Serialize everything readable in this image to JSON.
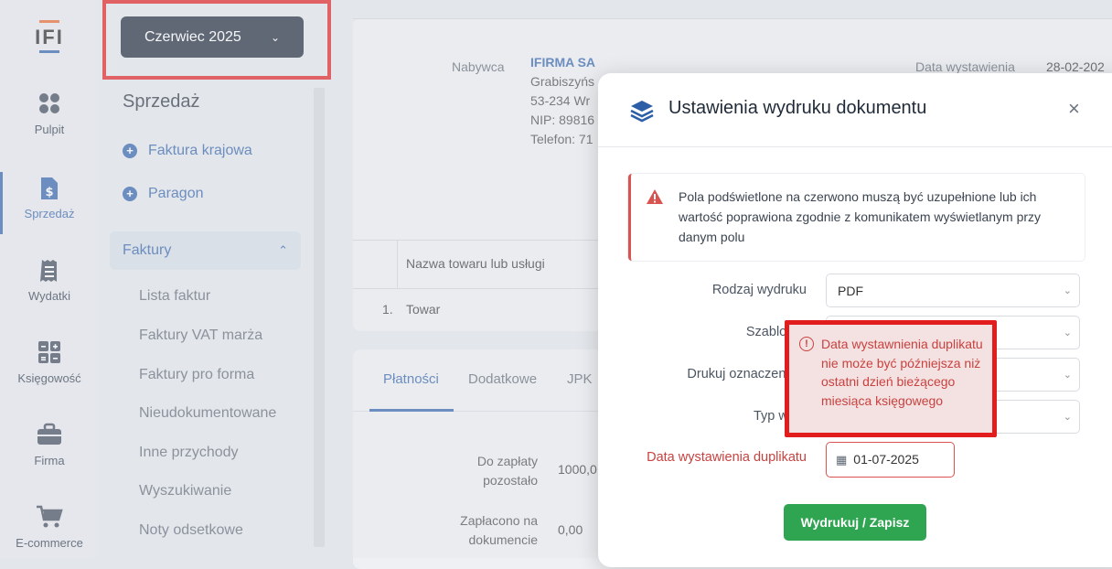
{
  "logo": {
    "text": "IFI"
  },
  "rail": {
    "items": [
      {
        "label": "Pulpit",
        "icon": "dashboard-icon"
      },
      {
        "label": "Sprzedaż",
        "icon": "invoice-dollar-icon"
      },
      {
        "label": "Wydatki",
        "icon": "receipt-icon"
      },
      {
        "label": "Księgowość",
        "icon": "calculator-icon"
      },
      {
        "label": "Firma",
        "icon": "briefcase-icon"
      },
      {
        "label": "E-commerce",
        "icon": "cart-icon"
      }
    ]
  },
  "sidebar": {
    "month_label": "Czerwiec 2025",
    "section_title": "Sprzedaż",
    "actions": [
      "Faktura krajowa",
      "Paragon"
    ],
    "group_label": "Faktury",
    "sub_items": [
      "Lista faktur",
      "Faktury VAT marża",
      "Faktury pro forma",
      "Nieudokumentowane",
      "Inne przychody",
      "Wyszukiwanie",
      "Noty odsetkowe"
    ]
  },
  "main": {
    "buyer_label": "Nabywca",
    "buyer_name": "IFIRMA SA",
    "buyer_lines": [
      "Grabiszyńs",
      "53-234 Wr",
      "NIP: 89816",
      "Telefon: 71"
    ],
    "issue_date_label": "Data wystawienia",
    "issue_date_value": "28-02-202",
    "table_header": "Nazwa towaru lub usługi",
    "row_index": "1.",
    "row_name": "Towar",
    "tabs": [
      "Płatności",
      "Dodatkowe",
      "JPK"
    ],
    "to_pay_label_1": "Do zapłaty",
    "to_pay_label_2": "pozostało",
    "to_pay_value": "1000,0",
    "paid_label_1": "Zapłacono na",
    "paid_label_2": "dokumencie",
    "paid_value": "0,00"
  },
  "modal": {
    "title": "Ustawienia wydruku dokumentu",
    "close": "×",
    "alert": "Pola podświetlone na czerwono muszą być uzupełnione lub ich wartość poprawiona zgodnie z komunikatem wyświetlanym przy danym polu",
    "fields": {
      "print_type_label": "Rodzaj wydruku",
      "print_type_value": "PDF",
      "template_label": "Szablon P",
      "marks_label": "Drukuj oznaczenia J",
      "print_kind_label": "Typ wydr",
      "dup_date_label": "Data wystawienia duplikatu",
      "dup_date_value": "01-07-2025"
    },
    "tooltip": "Data wystawnienia duplikatu nie może być późniejsza niż ostatni dzień bieżącego miesiąca księgowego",
    "print_button": "Wydrukuj / Zapisz"
  },
  "colors": {
    "accent": "#2d5fa8",
    "error": "#c8423f",
    "highlight": "#e11d1d",
    "success": "#2fa552",
    "dark_button": "#1b2538"
  }
}
